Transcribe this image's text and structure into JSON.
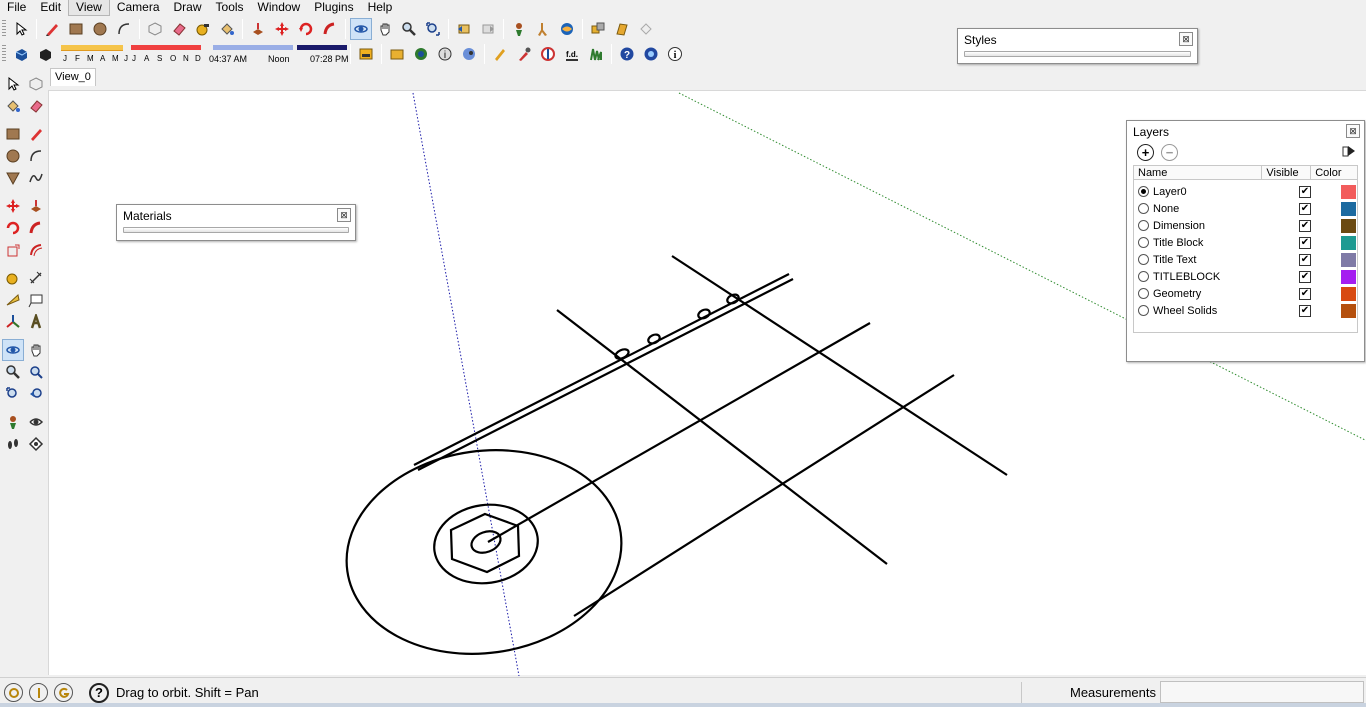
{
  "menu": [
    "File",
    "Edit",
    "View",
    "Camera",
    "Draw",
    "Tools",
    "Window",
    "Plugins",
    "Help"
  ],
  "menu_active": "View",
  "shadow": {
    "months": [
      "J",
      "F",
      "M",
      "A",
      "M",
      "J",
      "J",
      "A",
      "S",
      "O",
      "N",
      "D"
    ],
    "time_start": "04:37 AM",
    "time_noon": "Noon",
    "time_end": "07:28 PM"
  },
  "toolbar_icons_row1": [
    "select-icon",
    "pencil-icon",
    "rectangle-icon",
    "circle-icon",
    "arc-icon",
    "make-component-icon",
    "eraser-icon",
    "tape-measure-icon",
    "paint-bucket-icon",
    "push-pull-icon",
    "move-icon",
    "rotate-icon",
    "follow-me-icon",
    "orbit-icon",
    "pan-icon",
    "zoom-icon",
    "zoom-extents-icon",
    "previous-view-icon",
    "next-view-icon",
    "position-camera-icon",
    "walk-icon",
    "look-around-icon",
    "components-icon",
    "materials-icon",
    "styles-icon"
  ],
  "toolbar_icons_row2": [
    "shadows-toggle-icon",
    "fog-toggle-icon",
    "preview-icon",
    "get-models-icon",
    "share-model-icon",
    "photo-textures-icon",
    "google-earth-icon",
    "paint-icon",
    "dropper-icon",
    "walls-icon",
    "fd-icon",
    "grass-icon",
    "help-icon",
    "settings-icon",
    "info-icon"
  ],
  "tabs": [
    "View_0"
  ],
  "dialogs": {
    "styles_title": "Styles",
    "materials_title": "Materials",
    "layers_title": "Layers",
    "close_glyph": "⊠"
  },
  "layers": {
    "columns": [
      "Name",
      "Visible",
      "Color"
    ],
    "add_glyph": "+",
    "remove_glyph": "−",
    "rows": [
      {
        "name": "Layer0",
        "active": true,
        "visible": true,
        "color": "#f25c5c"
      },
      {
        "name": "None",
        "active": false,
        "visible": true,
        "color": "#1c6aa0"
      },
      {
        "name": "Dimension",
        "active": false,
        "visible": true,
        "color": "#6b4a12"
      },
      {
        "name": "Title Block",
        "active": false,
        "visible": true,
        "color": "#1e9a92"
      },
      {
        "name": "Title Text",
        "active": false,
        "visible": true,
        "color": "#7f7aa6"
      },
      {
        "name": "TITLEBLOCK",
        "active": false,
        "visible": true,
        "color": "#a51ef0"
      },
      {
        "name": "Geometry",
        "active": false,
        "visible": true,
        "color": "#d84a12"
      },
      {
        "name": "Wheel Solids",
        "active": false,
        "visible": true,
        "color": "#b5500e"
      }
    ]
  },
  "status": {
    "hint": "Drag to orbit.  Shift = Pan",
    "help_glyph": "?",
    "measurements_label": "Measurements",
    "measurements_value": ""
  },
  "colors": {
    "axis_blue": "#1a1aa8",
    "axis_green": "#2e8b2e",
    "accent": "#cfe3f7"
  }
}
